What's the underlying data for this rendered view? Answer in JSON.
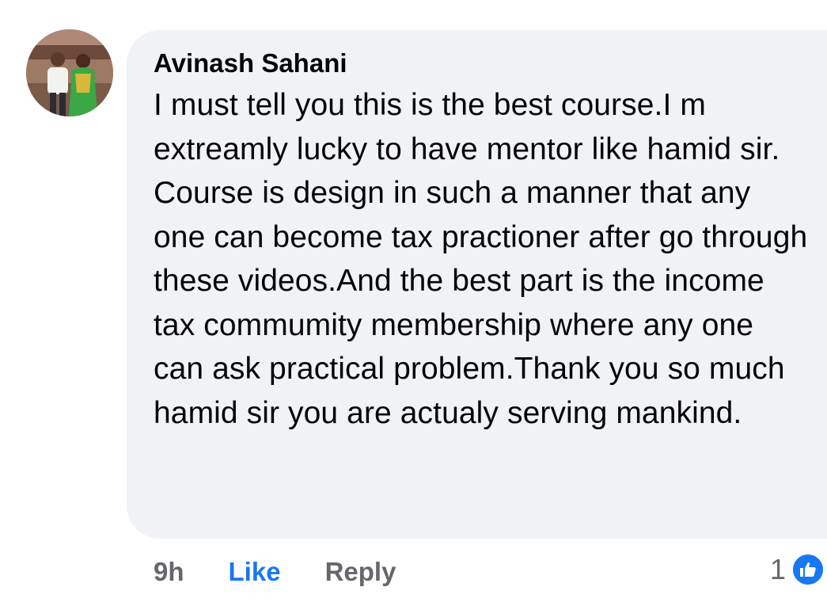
{
  "comment": {
    "author": "Avinash Sahani",
    "text": "I must tell you this is the best course.I m extreamly lucky to have mentor like hamid sir. Course is design in such a manner that any one can become tax practioner after go through these videos.And the best part is the income tax commumity membership where any one can ask practical problem.Thank you so much hamid sir you are actualy serving mankind.",
    "avatar_icon": "profile-photo-icon"
  },
  "actions": {
    "timestamp": "9h",
    "like_label": "Like",
    "reply_label": "Reply"
  },
  "reactions": {
    "count": "1",
    "icon": "thumbs-up-icon"
  },
  "colors": {
    "bubble_bg": "#f0f2f5",
    "like_blue": "#1877f2",
    "secondary_text": "#65676b",
    "primary_text": "#050505"
  }
}
